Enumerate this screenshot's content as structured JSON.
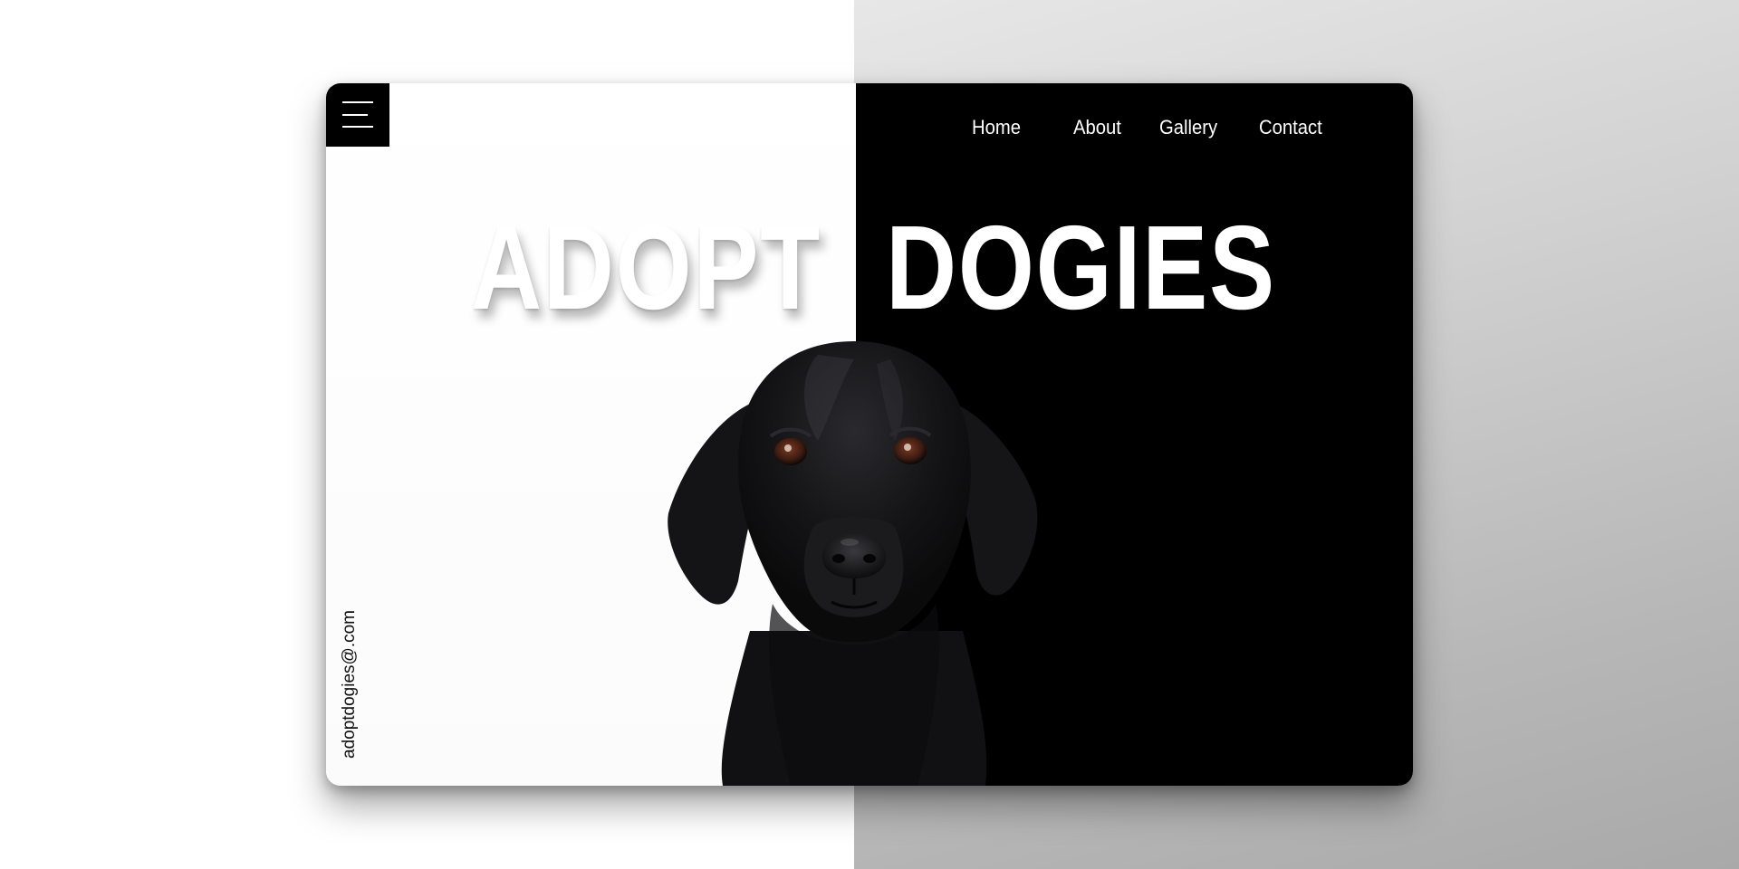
{
  "colors": {
    "card_left_bg": "#ffffff",
    "card_right_bg": "#000000",
    "accent_text": "#ffffff",
    "backdrop_gradient": [
      "#e7e7e7",
      "#a9a9a9"
    ]
  },
  "menu": {
    "icon": "hamburger-menu-icon"
  },
  "nav": {
    "items": [
      {
        "label": "Home"
      },
      {
        "label": "About"
      },
      {
        "label": "Gallery"
      },
      {
        "label": "Contact"
      }
    ]
  },
  "hero": {
    "word_left": "ADOPT",
    "word_right": "DOGIES"
  },
  "contact": {
    "email": "adoptdogies@.com"
  },
  "image": {
    "subject": "black-labrador-dog-portrait"
  }
}
